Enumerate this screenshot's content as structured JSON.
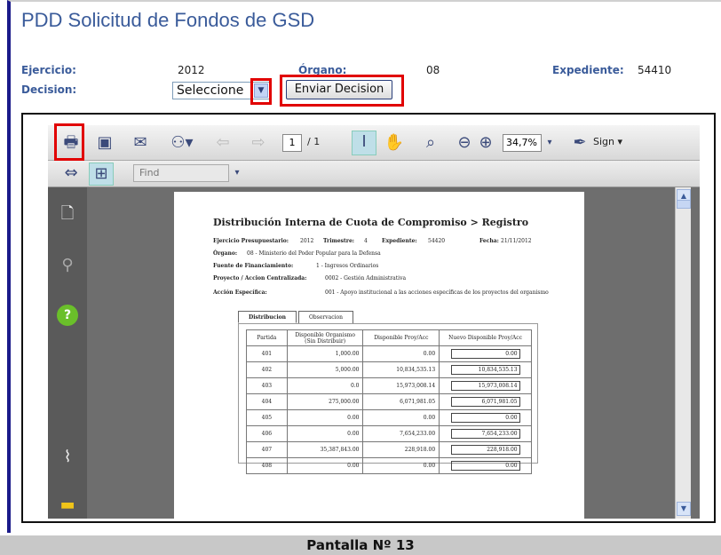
{
  "header": {
    "title": "PDD Solicitud de Fondos de GSD",
    "ejercicio_label": "Ejercicio:",
    "ejercicio_value": "2012",
    "organo_label": "Órgano:",
    "organo_value": "08",
    "expediente_label": "Expediente:",
    "expediente_value": "54410",
    "decision_label": "Decision:",
    "decision_select_value": "Seleccione",
    "submit_label": "Enviar Decision"
  },
  "pdf_toolbar": {
    "page_current": "1",
    "page_total": "/ 1",
    "zoom": "34,7%",
    "sign_label": "Sign",
    "find_placeholder": "Find"
  },
  "pdf": {
    "title": "Distribución Interna de Cuota de Compromiso > Registro",
    "ejercicio_label": "Ejercicio Presupuestario:",
    "ejercicio_value": "2012",
    "trimestre_label": "Trimestre:",
    "trimestre_value": "4",
    "expediente_label": "Expediente:",
    "expediente_value": "54420",
    "fecha_label": "Fecha:",
    "fecha_value": "21/11/2012",
    "organo_label": "Órgano:",
    "organo_value": "08 - Ministerio del Poder Popular para la Defensa",
    "fuente_label": "Fuente de Financiamiento:",
    "fuente_value": "1 - Ingresos Ordinarios",
    "proyecto_label": "Proyecto / Accion Centralizada:",
    "proyecto_value": "0002 - Gestión Administrativa",
    "accion_label": "Acción Específica:",
    "accion_value": "001 - Apoyo institucional a las acciones específicas de los proyectos del organismo",
    "tab_distribucion": "Distribucion",
    "tab_observacion": "Observacion",
    "columns": [
      "Partida",
      "Disponible Organismo (Sin Distribuir)",
      "Disponible Proy/Acc",
      "Nuevo Disponible Proy/Acc"
    ],
    "rows": [
      [
        "401",
        "1,000.00",
        "0.00",
        "0.00"
      ],
      [
        "402",
        "5,000.00",
        "10,834,535.13",
        "10,834,535.13"
      ],
      [
        "403",
        "0.0",
        "15,973,008.14",
        "15,973,008.14"
      ],
      [
        "404",
        "275,000.00",
        "6,071,981.05",
        "6,071,981.05"
      ],
      [
        "405",
        "0.00",
        "0.00",
        "0.00"
      ],
      [
        "406",
        "0.00",
        "7,654,233.00",
        "7,654,233.00"
      ],
      [
        "407",
        "35,387,843.00",
        "228,918.00",
        "228,918.00"
      ],
      [
        "408",
        "0.00",
        "0.00",
        "0.00"
      ]
    ]
  },
  "caption": "Pantalla Nº 13",
  "colors": {
    "label_blue": "#3a5b9a",
    "highlight_red": "#e10000",
    "viewer_bg": "#6e6e6e"
  }
}
